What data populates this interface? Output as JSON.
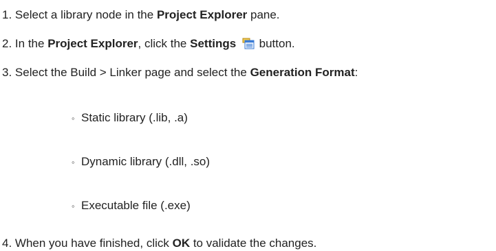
{
  "steps": [
    {
      "number": "1.",
      "parts": [
        "Select a library node in the ",
        "Project Explorer",
        " pane."
      ]
    },
    {
      "number": "2.",
      "parts": [
        "In the ",
        "Project Explorer",
        ", click the ",
        "Settings",
        "button."
      ],
      "icon": "settings-icon"
    },
    {
      "number": "3.",
      "parts": [
        "Select the Build > Linker page and select the ",
        "Generation Format",
        ":"
      ]
    },
    {
      "number": "4.",
      "parts": [
        "When you have finished, click ",
        "OK",
        " to validate the changes."
      ]
    }
  ],
  "options": {
    "bullet": "◦",
    "items": [
      "Static library (.lib, .a)",
      "Dynamic library (.dll, .so)",
      "Executable file (.exe)"
    ]
  },
  "colors": {
    "text": "#222222",
    "icon_blue": "#3a7bd5",
    "icon_yellow": "#f2c94c"
  }
}
